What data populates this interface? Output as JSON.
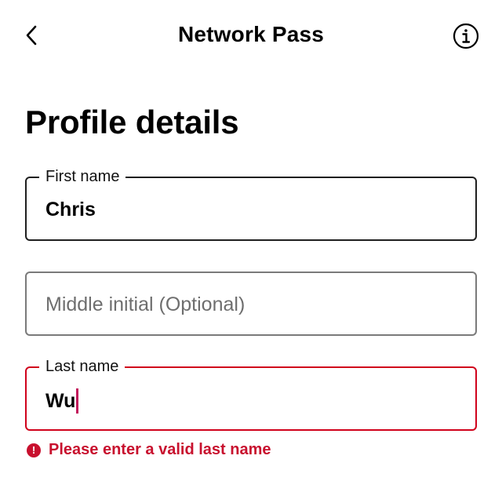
{
  "header": {
    "title": "Network Pass",
    "back_icon": "chevron-left-icon",
    "info_icon": "info-icon"
  },
  "page": {
    "heading": "Profile details"
  },
  "form": {
    "first_name": {
      "label": "First name",
      "value": "Chris"
    },
    "middle_initial": {
      "placeholder": "Middle initial (Optional)"
    },
    "last_name": {
      "label": "Last name",
      "value": "Wu",
      "error": "Please enter a valid last name"
    }
  },
  "colors": {
    "error": "#c8102e",
    "caret": "#c2185b",
    "border": "#1f1f1f",
    "placeholder": "#6e6e6e"
  }
}
